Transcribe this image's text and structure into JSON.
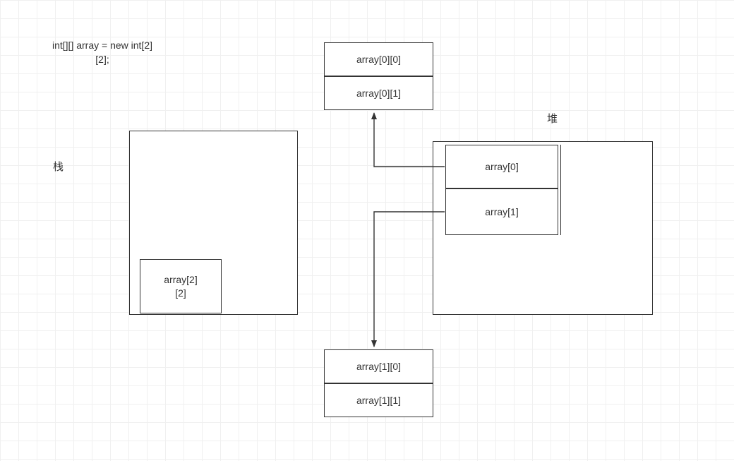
{
  "declaration": {
    "line1": "int[][] array = new int[2]",
    "line2": "[2];"
  },
  "labels": {
    "stack": "栈",
    "heap": "堆"
  },
  "stackBox": {
    "cell": {
      "line1": "array[2]",
      "line2": "[2]"
    }
  },
  "heapBox": {
    "row0": "array[0]",
    "row1": "array[1]"
  },
  "topCells": {
    "c0": "array[0][0]",
    "c1": "array[0][1]"
  },
  "bottomCells": {
    "c0": "array[1][0]",
    "c1": "array[1][1]"
  }
}
